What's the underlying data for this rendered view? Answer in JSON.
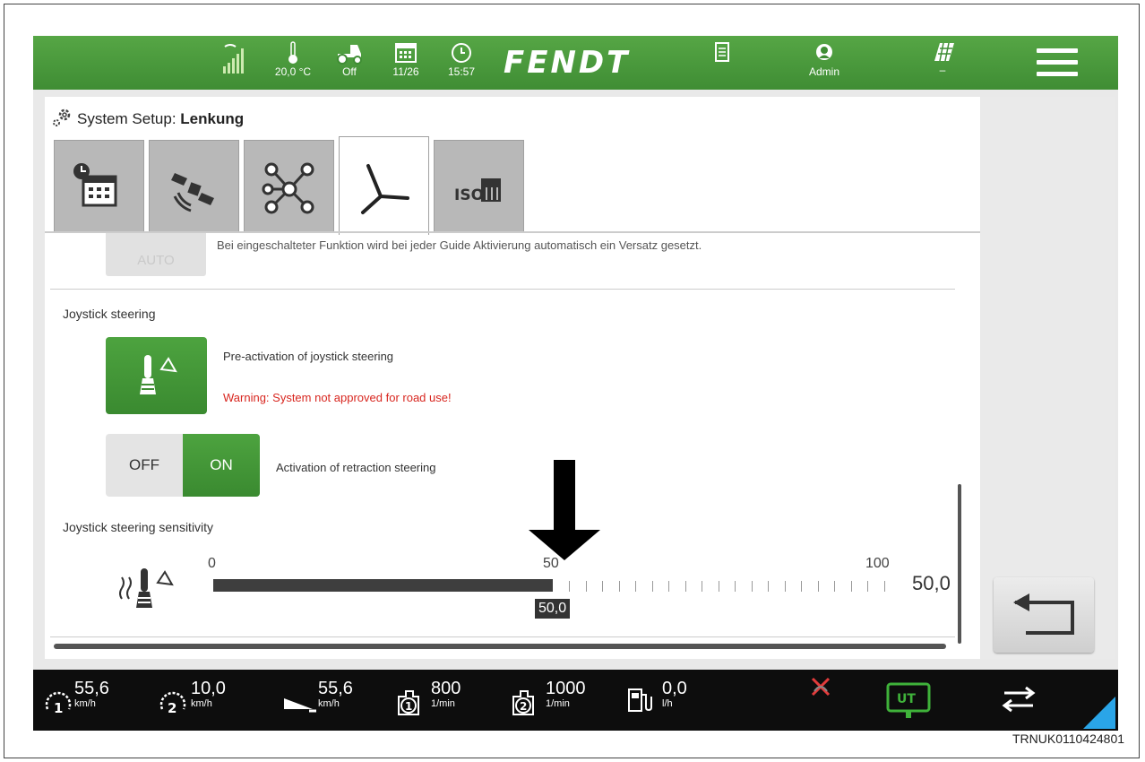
{
  "topbar": {
    "temperature": "20,0 °C",
    "tractor_status": "Off",
    "date": "11/26",
    "time": "15:57",
    "brand": "FENDT",
    "user": "Admin",
    "field_status": "–"
  },
  "page": {
    "title_prefix": "System Setup: ",
    "title_bold": "Lenkung"
  },
  "tabs": [
    {
      "name": "time-date"
    },
    {
      "name": "gps"
    },
    {
      "name": "network"
    },
    {
      "name": "steering"
    },
    {
      "name": "isobus",
      "label": "ISO"
    }
  ],
  "content": {
    "auto_button": "AUTO",
    "auto_desc": "Bei eingeschalteter Funktion wird bei jeder Guide Aktivierung automatisch ein Versatz gesetzt.",
    "joystick_section": "Joystick steering",
    "preactivation_label": "Pre-activation of joystick steering",
    "warning": "Warning: System not approved for road use!",
    "toggle_off": "OFF",
    "toggle_on": "ON",
    "toggle_state": "ON",
    "retraction_label": "Activation of retraction steering",
    "sensitivity_section": "Joystick steering sensitivity",
    "slider_min": "0",
    "slider_mid": "50",
    "slider_max": "100",
    "slider_value": "50,0",
    "slider_level": 50
  },
  "bottombar": {
    "speed1": "55,6",
    "speed1_unit": "km/h",
    "speed2": "10,0",
    "speed2_unit": "km/h",
    "speed3": "55,6",
    "speed3_unit": "km/h",
    "rpm1": "800",
    "rpm1_unit": "1/min",
    "rpm2": "1000",
    "rpm2_unit": "1/min",
    "fuel": "0,0",
    "fuel_unit": "l/h",
    "ut_label": "UT"
  },
  "reference_code": "TRNUK0110424801",
  "colors": {
    "brand_green": "#3f8d34",
    "warning_red": "#d8261f",
    "accent_blue": "#2aa5e8"
  }
}
